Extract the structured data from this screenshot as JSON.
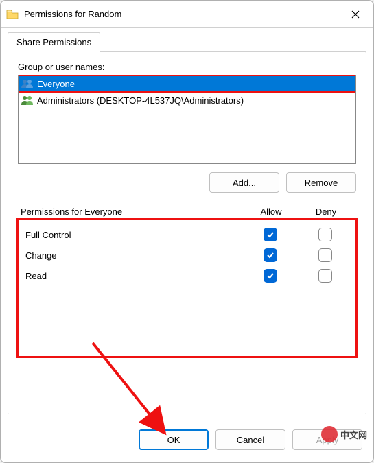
{
  "window": {
    "title": "Permissions for Random"
  },
  "tab": {
    "label": "Share Permissions"
  },
  "groupLabel": "Group or user names:",
  "users": {
    "0": {
      "name": "Everyone"
    },
    "1": {
      "name": "Administrators (DESKTOP-4L537JQ\\Administrators)"
    }
  },
  "buttons": {
    "add": "Add...",
    "remove": "Remove",
    "ok": "OK",
    "cancel": "Cancel",
    "apply": "Apply"
  },
  "permHeader": {
    "label": "Permissions for Everyone",
    "allow": "Allow",
    "deny": "Deny"
  },
  "perms": {
    "0": {
      "name": "Full Control"
    },
    "1": {
      "name": "Change"
    },
    "2": {
      "name": "Read"
    }
  },
  "watermark": "中文网"
}
